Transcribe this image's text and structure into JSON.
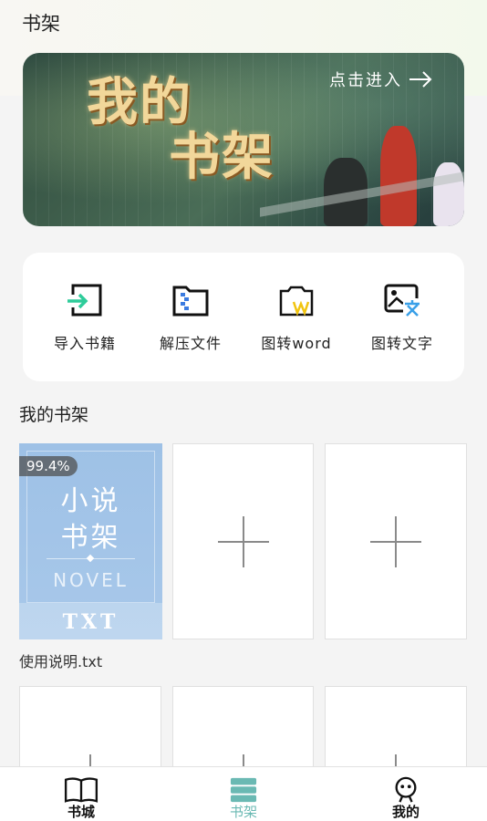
{
  "header": {
    "title": "书架"
  },
  "banner": {
    "title_line1": "我的",
    "title_line2": "书架",
    "enter_label": "点击进入"
  },
  "tools": [
    {
      "label": "导入书籍",
      "icon": "import-icon"
    },
    {
      "label": "解压文件",
      "icon": "unzip-folder-icon"
    },
    {
      "label": "图转word",
      "icon": "image-to-word-icon"
    },
    {
      "label": "图转文字",
      "icon": "image-to-text-icon"
    }
  ],
  "shelf": {
    "title": "我的书架",
    "book": {
      "progress": "99.4%",
      "cover_title_line1": "小说",
      "cover_title_line2": "书架",
      "cover_subtitle": "NOVEL",
      "cover_type": "TXT",
      "filename": "使用说明.txt"
    }
  },
  "nav": {
    "items": [
      {
        "label": "书城",
        "icon": "book-open-icon",
        "active": false
      },
      {
        "label": "书架",
        "icon": "bookshelf-icon",
        "active": true
      },
      {
        "label": "我的",
        "icon": "profile-icon",
        "active": false
      }
    ],
    "active_color": "#6ab9b3"
  }
}
